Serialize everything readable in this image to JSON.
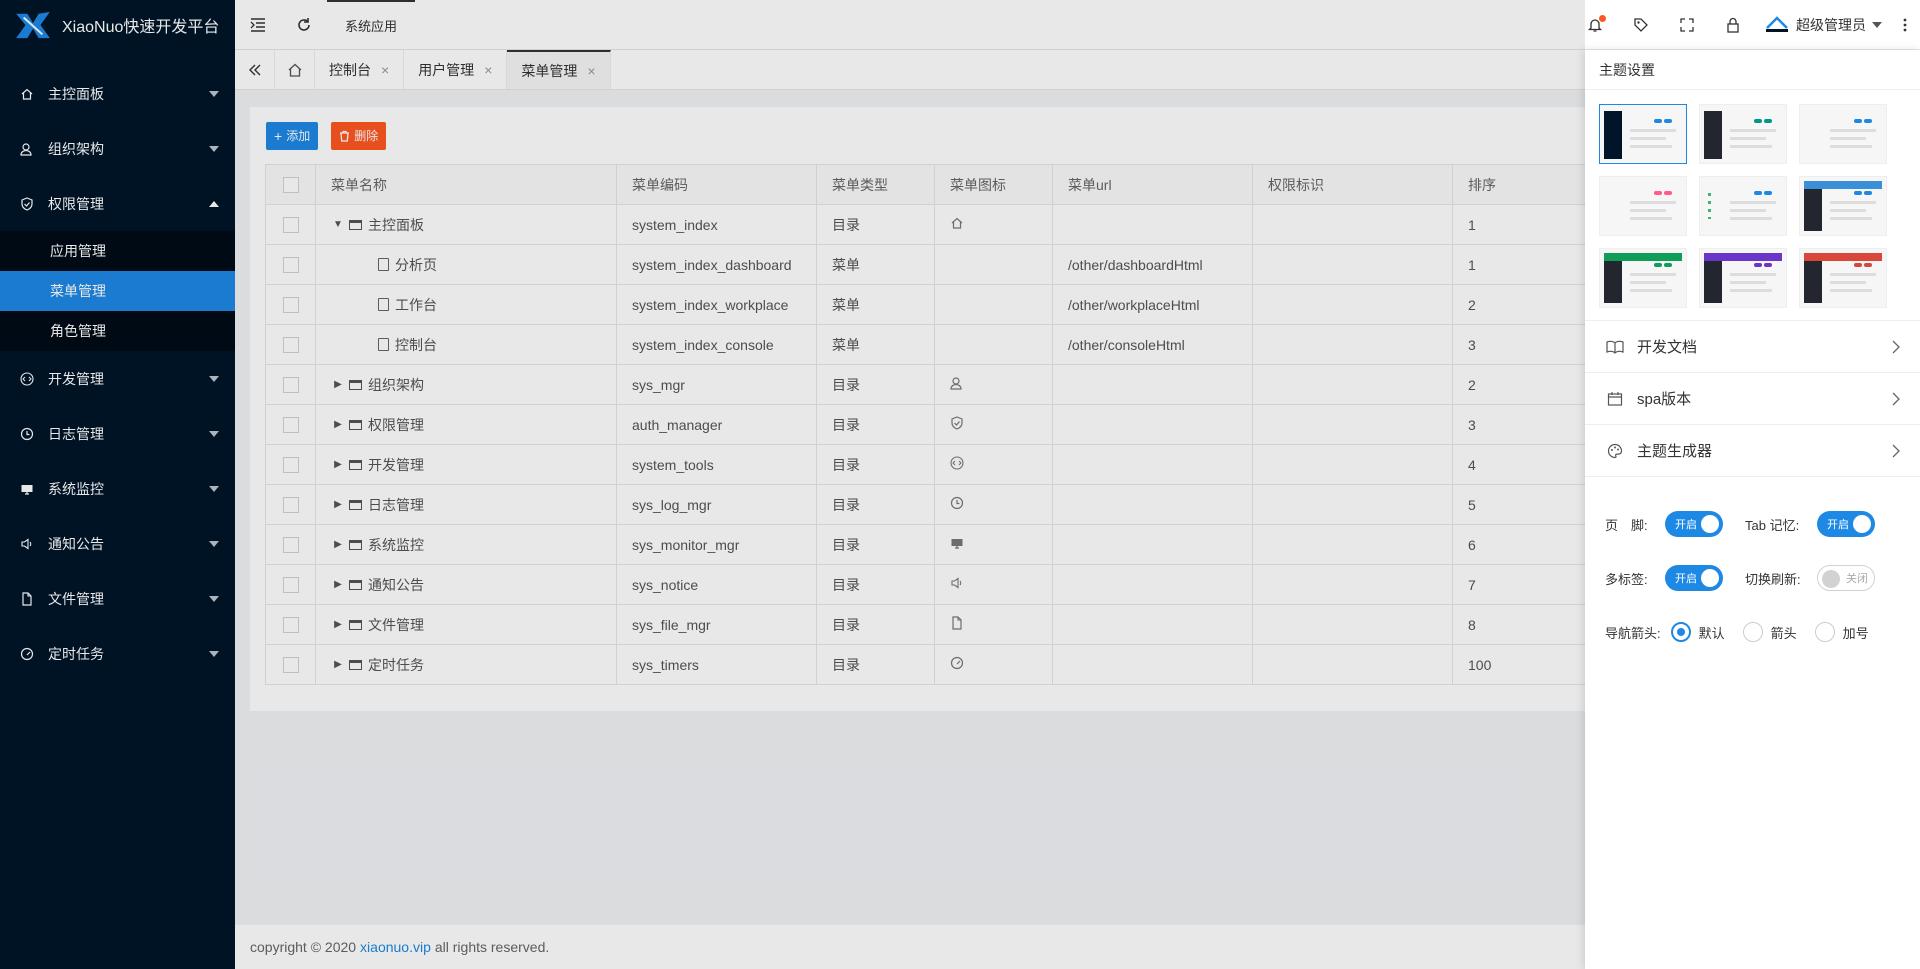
{
  "brand": {
    "name": "XiaoNuo快速开发平台"
  },
  "sidebar": {
    "items": [
      {
        "label": "主控面板",
        "icon": "home-icon"
      },
      {
        "label": "组织架构",
        "icon": "user-icon"
      },
      {
        "label": "权限管理",
        "icon": "shield-icon",
        "expanded": true,
        "children": [
          {
            "label": "应用管理"
          },
          {
            "label": "菜单管理",
            "active": true
          },
          {
            "label": "角色管理"
          }
        ]
      },
      {
        "label": "开发管理",
        "icon": "code-icon"
      },
      {
        "label": "日志管理",
        "icon": "clock-icon"
      },
      {
        "label": "系统监控",
        "icon": "monitor-icon"
      },
      {
        "label": "通知公告",
        "icon": "speaker-icon"
      },
      {
        "label": "文件管理",
        "icon": "file-icon"
      },
      {
        "label": "定时任务",
        "icon": "gauge-icon"
      }
    ]
  },
  "header": {
    "app_tab": "系统应用",
    "username": "超级管理员"
  },
  "tabs": [
    {
      "label": "控制台",
      "closable": true
    },
    {
      "label": "用户管理",
      "closable": true
    },
    {
      "label": "菜单管理",
      "closable": true,
      "active": true
    }
  ],
  "toolbar": {
    "add_label": "添加",
    "delete_label": "删除"
  },
  "table": {
    "columns": [
      "菜单名称",
      "菜单编码",
      "菜单类型",
      "菜单图标",
      "菜单url",
      "权限标识",
      "排序"
    ],
    "rows": [
      {
        "name": "主控面板",
        "code": "system_index",
        "type": "目录",
        "icon": "home-icon",
        "url": "",
        "perm": "",
        "sort": "1",
        "level": 0,
        "expanded": true
      },
      {
        "name": "分析页",
        "code": "system_index_dashboard",
        "type": "菜单",
        "icon": "",
        "url": "/other/dashboardHtml",
        "perm": "",
        "sort": "1",
        "level": 1
      },
      {
        "name": "工作台",
        "code": "system_index_workplace",
        "type": "菜单",
        "icon": "",
        "url": "/other/workplaceHtml",
        "perm": "",
        "sort": "2",
        "level": 1
      },
      {
        "name": "控制台",
        "code": "system_index_console",
        "type": "菜单",
        "icon": "",
        "url": "/other/consoleHtml",
        "perm": "",
        "sort": "3",
        "level": 1
      },
      {
        "name": "组织架构",
        "code": "sys_mgr",
        "type": "目录",
        "icon": "user-icon",
        "url": "",
        "perm": "",
        "sort": "2",
        "level": 0
      },
      {
        "name": "权限管理",
        "code": "auth_manager",
        "type": "目录",
        "icon": "shield-icon",
        "url": "",
        "perm": "",
        "sort": "3",
        "level": 0
      },
      {
        "name": "开发管理",
        "code": "system_tools",
        "type": "目录",
        "icon": "code-icon",
        "url": "",
        "perm": "",
        "sort": "4",
        "level": 0
      },
      {
        "name": "日志管理",
        "code": "sys_log_mgr",
        "type": "目录",
        "icon": "clock-icon",
        "url": "",
        "perm": "",
        "sort": "5",
        "level": 0
      },
      {
        "name": "系统监控",
        "code": "sys_monitor_mgr",
        "type": "目录",
        "icon": "monitor-icon",
        "url": "",
        "perm": "",
        "sort": "6",
        "level": 0
      },
      {
        "name": "通知公告",
        "code": "sys_notice",
        "type": "目录",
        "icon": "speaker-icon",
        "url": "",
        "perm": "",
        "sort": "7",
        "level": 0
      },
      {
        "name": "文件管理",
        "code": "sys_file_mgr",
        "type": "目录",
        "icon": "file-icon",
        "url": "",
        "perm": "",
        "sort": "8",
        "level": 0
      },
      {
        "name": "定时任务",
        "code": "sys_timers",
        "type": "目录",
        "icon": "gauge-icon",
        "url": "",
        "perm": "",
        "sort": "100",
        "level": 0
      }
    ]
  },
  "footer": {
    "prefix": "copyright © 2020",
    "link": "xiaonuo.vip",
    "suffix": "all rights reserved."
  },
  "theme_panel": {
    "title": "主题设置",
    "themes": [
      {
        "side": "#001529",
        "top": "",
        "accent": "#1e88e5",
        "selected": true
      },
      {
        "side": "#23262e",
        "top": "",
        "accent": "#009688"
      },
      {
        "side": "",
        "top": "",
        "accent": "#1e88e5"
      },
      {
        "side": "",
        "top": "",
        "accent": "#ff5c8a"
      },
      {
        "side": "dots",
        "top": "",
        "accent": "#1e88e5"
      },
      {
        "side": "#23262e",
        "top": "#3b8fd6",
        "accent": "#1e88e5"
      },
      {
        "side": "#23262e",
        "top": "#0f9d58",
        "accent": "#0f9d58"
      },
      {
        "side": "#23262e",
        "top": "#6a35c9",
        "accent": "#6a35c9"
      },
      {
        "side": "#23262e",
        "top": "#d9473b",
        "accent": "#d9473b"
      }
    ],
    "links": [
      {
        "label": "开发文档",
        "icon": "book-icon"
      },
      {
        "label": "spa版本",
        "icon": "calendar-icon"
      },
      {
        "label": "主题生成器",
        "icon": "palette-icon"
      }
    ],
    "settings": {
      "footer_label": "页　脚:",
      "footer_state": "开启",
      "tab_memory_label": "Tab 记忆:",
      "tab_memory_state": "开启",
      "multi_tab_label": "多标签:",
      "multi_tab_state": "开启",
      "switch_refresh_label": "切换刷新:",
      "switch_refresh_state": "关闭",
      "nav_arrow_label": "导航箭头:",
      "nav_options": [
        "默认",
        "箭头",
        "加号"
      ],
      "nav_selected": 0
    }
  },
  "colors": {
    "sidebar_bg": "#001529",
    "accent": "#1e88e5",
    "danger": "#ff5722"
  }
}
